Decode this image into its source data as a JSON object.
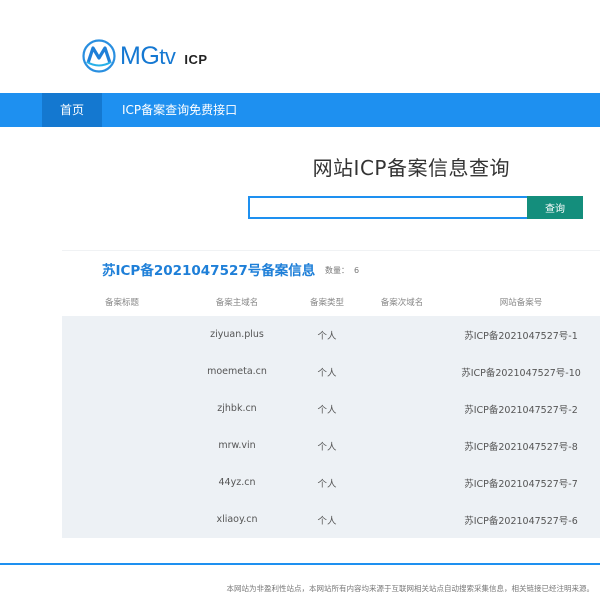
{
  "brand": {
    "name_main": "MG",
    "name_tv": "tv",
    "sub": "ICP",
    "accent": "#1578d2"
  },
  "nav": {
    "items": [
      {
        "label": "首页",
        "active": true
      },
      {
        "label": "ICP备案查询免费接口",
        "active": false
      }
    ],
    "bg": "#1e90f0"
  },
  "search": {
    "title": "网站ICP备案信息查询",
    "input_value": "",
    "placeholder": "",
    "button_label": "查询",
    "button_color": "#148e7c"
  },
  "result": {
    "title": "苏ICP备2021047527号备案信息",
    "count_label": "数量：",
    "count_value": "6",
    "columns": [
      "备案标题",
      "备案主域名",
      "备案类型",
      "备案次域名",
      "网站备案号"
    ],
    "rows": [
      {
        "title": "",
        "domain": "ziyuan.plus",
        "type": "个人",
        "subdomain": "",
        "record_no": "苏ICP备2021047527号-1"
      },
      {
        "title": "",
        "domain": "moemeta.cn",
        "type": "个人",
        "subdomain": "",
        "record_no": "苏ICP备2021047527号-10"
      },
      {
        "title": "",
        "domain": "zjhbk.cn",
        "type": "个人",
        "subdomain": "",
        "record_no": "苏ICP备2021047527号-2"
      },
      {
        "title": "",
        "domain": "mrw.vin",
        "type": "个人",
        "subdomain": "",
        "record_no": "苏ICP备2021047527号-8"
      },
      {
        "title": "",
        "domain": "44yz.cn",
        "type": "个人",
        "subdomain": "",
        "record_no": "苏ICP备2021047527号-7"
      },
      {
        "title": "",
        "domain": "xliaoy.cn",
        "type": "个人",
        "subdomain": "",
        "record_no": "苏ICP备2021047527号-6"
      }
    ]
  },
  "footer": {
    "text": "本网站为非盈利性站点，本网站所有内容均来源于互联网相关站点自动搜索采集信息，相关链接已经注明来源。"
  }
}
